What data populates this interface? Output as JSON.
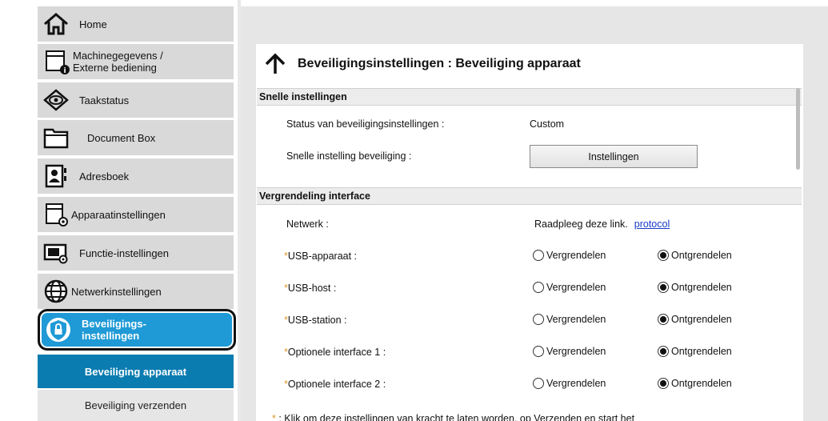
{
  "sidebar": {
    "items": [
      {
        "label": "Home",
        "icon": "home-icon"
      },
      {
        "label": "Machinegegevens /",
        "label2": "Externe bediening",
        "icon": "machine-info-icon"
      },
      {
        "label": "Taakstatus",
        "icon": "eye-icon"
      },
      {
        "label": "Document Box",
        "icon": "folder-icon"
      },
      {
        "label": "Adresboek",
        "icon": "address-book-icon"
      },
      {
        "label": "Apparaatinstellingen",
        "icon": "device-settings-icon"
      },
      {
        "label": "Functie-instellingen",
        "icon": "function-settings-icon"
      },
      {
        "label": "Netwerkinstellingen",
        "icon": "globe-icon"
      },
      {
        "label": "Beveiligings-",
        "label2": "instellingen",
        "icon": "shield-lock-icon"
      }
    ],
    "sub_active": "Beveiliging apparaat",
    "sub_item": "Beveiliging verzenden"
  },
  "main": {
    "title": "Beveiligingsinstellingen : Beveiliging apparaat",
    "quick": {
      "header": "Snelle instellingen",
      "status_label": "Status van beveiligingsinstellingen :",
      "status_value": "Custom",
      "quick_label": "Snelle instelling beveiliging :",
      "button": "Instellingen"
    },
    "lock": {
      "header": "Vergrendeling interface",
      "network_label": "Netwerk :",
      "network_text": "Raadpleeg deze link.",
      "network_link": "protocol",
      "lock_option": "Vergrendelen",
      "unlock_option": "Ontgrendelen",
      "rows": [
        {
          "label": "USB-apparaat :",
          "value": "Ontgrendelen"
        },
        {
          "label": "USB-host :",
          "value": "Ontgrendelen"
        },
        {
          "label": "USB-station :",
          "value": "Ontgrendelen"
        },
        {
          "label": "Optionele interface 1 :",
          "value": "Ontgrendelen"
        },
        {
          "label": "Optionele interface 2 :",
          "value": "Ontgrendelen"
        }
      ]
    },
    "footnote": "Klik om deze instellingen van kracht te laten worden, op Verzenden en start het"
  },
  "colors": {
    "active": "#1f9ad6",
    "sub_active": "#0b7cb0",
    "required": "#e09a2a",
    "link": "#1a3cc8"
  }
}
